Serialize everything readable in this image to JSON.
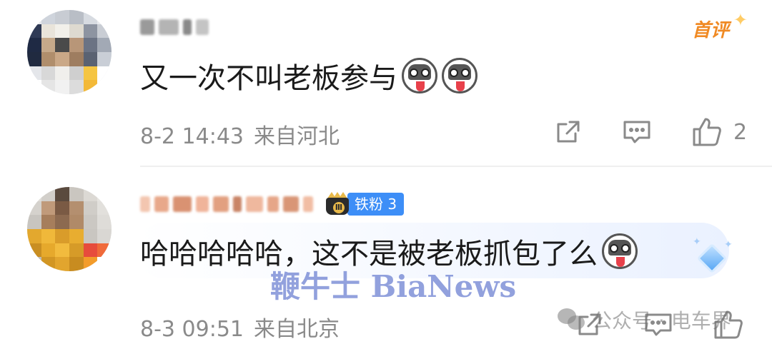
{
  "comments": [
    {
      "content": "又一次不叫老板参与",
      "first_badge": "首评",
      "time": "8-2 14:43",
      "location": "来自河北",
      "like_count": "2",
      "emojis": [
        "husky-emoji",
        "husky-emoji"
      ]
    },
    {
      "content": "哈哈哈哈哈，这不是被老板抓包了么",
      "fan_badge": "铁粉 3",
      "fan_level": "Ⅲ",
      "time": "8-3 09:51",
      "location": "来自北京",
      "like_count": "",
      "emojis": [
        "husky-emoji"
      ]
    }
  ],
  "watermarks": {
    "bianews": "鞭牛士 BiaNews",
    "wechat": "公众号 · 电车界"
  },
  "colors": {
    "accent_blue": "#3d8ef7",
    "first_badge_orange": "#f08a24",
    "meta_gray": "#8a8a8a",
    "watermark_blue": "#6e82d2"
  }
}
